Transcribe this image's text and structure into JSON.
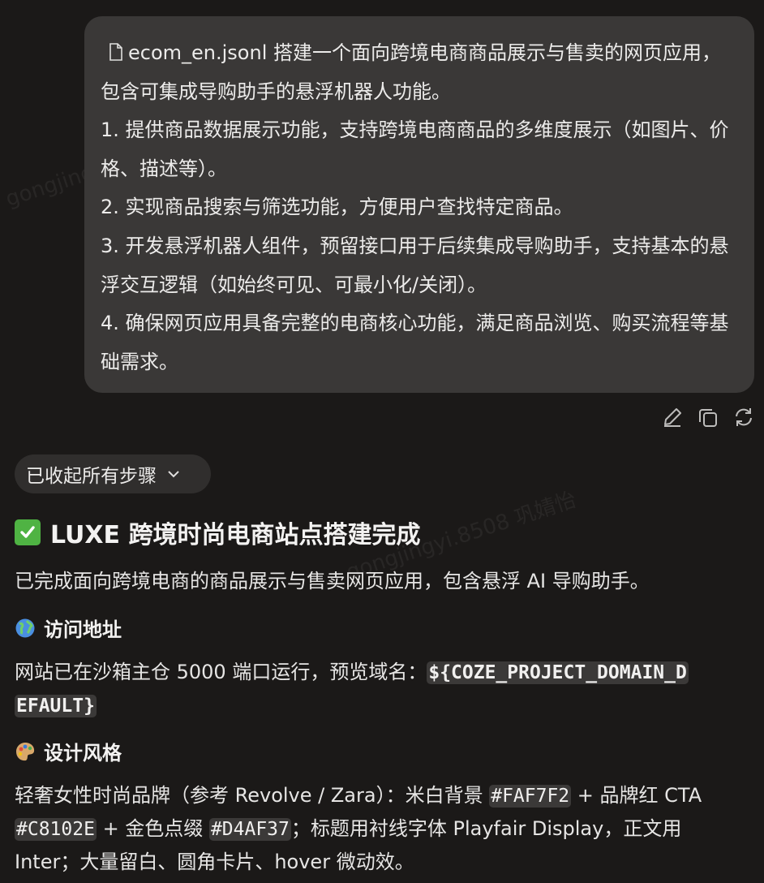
{
  "user_message": {
    "file_name": "ecom_en.jsonl",
    "text": "搭建一个面向跨境电商商品展示与售卖的网页应用，包含可集成导购助手的悬浮机器人功能。",
    "items": [
      "1. 提供商品数据展示功能，支持跨境电商商品的多维度展示（如图片、价格、描述等）。",
      "2. 实现商品搜索与筛选功能，方便用户查找特定商品。",
      "3. 开发悬浮机器人组件，预留接口用于后续集成导购助手，支持基本的悬浮交互逻辑（如始终可见、可最小化/关闭）。",
      "4. 确保网页应用具备完整的电商核心功能，满足商品浏览、购买流程等基础需求。"
    ]
  },
  "message_actions": [
    "edit-icon",
    "copy-icon",
    "regenerate-icon"
  ],
  "steps_toggle": "已收起所有步骤",
  "response": {
    "title": "LUXE 跨境时尚电商站点搭建完成",
    "intro": "已完成面向跨境电商的商品展示与售卖网页应用，包含悬浮 AI 导购助手。",
    "access": {
      "heading": "访问地址",
      "text": "网站已在沙箱主仓 5000 端口运行，预览域名：",
      "domain_a": "${COZE_PROJECT_DOMAIN_D",
      "domain_b": "EFAULT}"
    },
    "design": {
      "heading": "设计风格",
      "line1_a": "轻奢女性时尚品牌（参考 Revolve / Zara）：米白背景 ",
      "color1": "#FAF7F2",
      "line1_b": " + 品牌红 CTA",
      "color2": "#C8102E",
      "line2_a": " + 金色点缀 ",
      "color3": "#D4AF37",
      "line2_b": "；标题用衬线字体 Playfair Display，正文用",
      "line3": "Inter；大量留白、圆角卡片、hover 微动效。"
    }
  },
  "watermark": "gongjingyi.8508  巩婧怡"
}
